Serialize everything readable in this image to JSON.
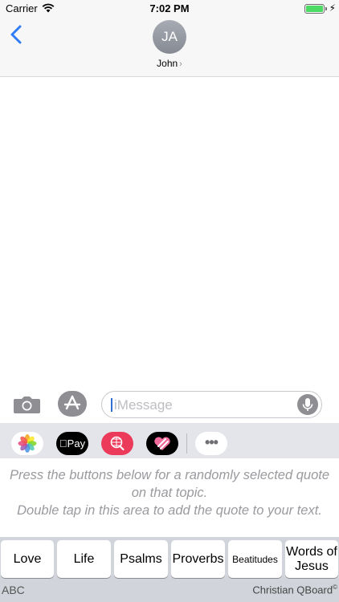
{
  "status_bar": {
    "carrier": "Carrier",
    "time": "7:02 PM",
    "battery_level": 1.0,
    "battery_color": "#4cd964"
  },
  "header": {
    "avatar_initials": "JA",
    "contact_name": "John",
    "contact_chevron": "›",
    "back_icon": "chevron-left-icon",
    "accent_color": "#2f7cf6"
  },
  "compose": {
    "camera_icon": "camera-icon",
    "appstore_icon": "app-store-icon",
    "message_placeholder": "iMessage",
    "mic_icon": "microphone-icon"
  },
  "app_drawer": {
    "apps": [
      {
        "name": "photos",
        "icon": "photos-icon"
      },
      {
        "name": "apple-pay",
        "icon": "apple-pay-icon",
        "label": "Pay"
      },
      {
        "name": "image-search",
        "icon": "globe-search-icon"
      },
      {
        "name": "hearts",
        "icon": "heart-icon"
      }
    ],
    "more_label": "•••"
  },
  "keyboard": {
    "instructions": [
      "Press the buttons below for a randomly selected quote on that topic.",
      "Double tap in this area to add the quote to your text."
    ],
    "topics": [
      {
        "label": "Love"
      },
      {
        "label": "Life"
      },
      {
        "label": "Psalms"
      },
      {
        "label": "Proverbs"
      },
      {
        "label": "Beatitudes"
      },
      {
        "label": "Words of Jesus"
      }
    ],
    "abc_label": "ABC",
    "brand": "Christian QBoard",
    "brand_mark": "©"
  }
}
